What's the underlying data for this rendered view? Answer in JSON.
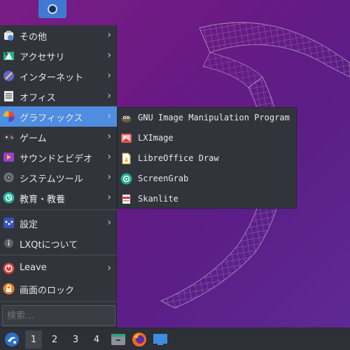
{
  "menu": {
    "items": [
      {
        "label": "その他",
        "icon": "other-icon",
        "arrow": "›"
      },
      {
        "label": "アクセサリ",
        "icon": "accessories-icon",
        "arrow": "›"
      },
      {
        "label": "インターネット",
        "icon": "internet-icon",
        "arrow": "›"
      },
      {
        "label": "オフィス",
        "icon": "office-icon",
        "arrow": "›"
      },
      {
        "label": "グラフィックス",
        "icon": "graphics-icon",
        "arrow": "›"
      },
      {
        "label": "ゲーム",
        "icon": "games-icon",
        "arrow": "›"
      },
      {
        "label": "サウンドとビデオ",
        "icon": "sound-video-icon",
        "arrow": "›"
      },
      {
        "label": "システムツール",
        "icon": "system-tools-icon",
        "arrow": "›"
      },
      {
        "label": "教育・教養",
        "icon": "education-icon",
        "arrow": "›"
      },
      {
        "label": "設定",
        "icon": "settings-icon",
        "arrow": "›"
      },
      {
        "label": "LXQtについて",
        "icon": "info-icon"
      },
      {
        "label": "Leave",
        "icon": "power-icon",
        "arrow": "›"
      },
      {
        "label": "画面のロック",
        "icon": "lock-icon"
      }
    ],
    "active_label": "グラフィックス",
    "search_placeholder": "検索..."
  },
  "submenu": {
    "items": [
      {
        "label": "GNU Image Manipulation Program",
        "icon": "gimp-icon"
      },
      {
        "label": "LXImage",
        "icon": "lximage-icon"
      },
      {
        "label": "LibreOffice Draw",
        "icon": "libreoffice-draw-icon"
      },
      {
        "label": "ScreenGrab",
        "icon": "screengrab-icon"
      },
      {
        "label": "Skanlite",
        "icon": "skanlite-icon"
      }
    ]
  },
  "taskbar": {
    "workspaces": [
      "1",
      "2",
      "3",
      "4"
    ],
    "active_workspace": "1",
    "launchers": [
      "file-manager-icon",
      "firefox-icon",
      "show-desktop-icon"
    ]
  },
  "colors": {
    "accent": "#4f8de0",
    "menu_bg": "#31343b",
    "taskbar_bg": "#2d3037"
  }
}
